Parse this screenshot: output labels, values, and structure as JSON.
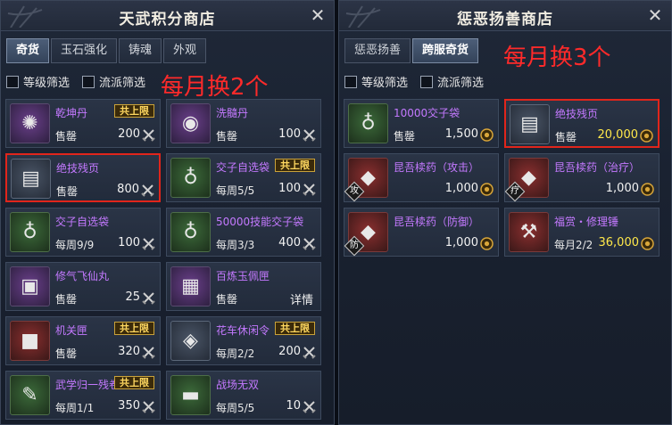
{
  "left": {
    "title": "天武积分商店",
    "close": "✕",
    "tabs": [
      {
        "label": "奇货",
        "active": true
      },
      {
        "label": "玉石强化",
        "active": false
      },
      {
        "label": "铸魂",
        "active": false
      },
      {
        "label": "外观",
        "active": false
      }
    ],
    "filters": [
      "等级筛选",
      "流派筛选"
    ],
    "annotation": "每月换2个",
    "items": [
      {
        "name": "乾坤丹",
        "limit": "共上限",
        "sub": "售罄",
        "price": "200",
        "icon": "golden-orb-icon",
        "thumb": "purple",
        "glyph": "✺"
      },
      {
        "name": "洗髓丹",
        "limit": "",
        "sub": "售罄",
        "price": "100",
        "icon": "pink-orb-icon",
        "thumb": "purple",
        "glyph": "◉"
      },
      {
        "name": "绝技残页",
        "limit": "",
        "sub": "售罄",
        "price": "800",
        "icon": "scroll-page-icon",
        "thumb": "blue",
        "glyph": "▤",
        "highlight": true
      },
      {
        "name": "交子自选袋",
        "limit": "共上限",
        "sub": "每周5/5",
        "price": "100",
        "icon": "money-bag-icon",
        "thumb": "green",
        "glyph": "♁"
      },
      {
        "name": "交子自选袋",
        "limit": "",
        "sub": "每周9/9",
        "price": "100",
        "icon": "money-bag-icon",
        "thumb": "green",
        "glyph": "♁"
      },
      {
        "name": "50000技能交子袋",
        "limit": "",
        "sub": "每周3/3",
        "price": "400",
        "icon": "money-bag-icon",
        "thumb": "green",
        "glyph": "♁"
      },
      {
        "name": "修气飞仙丸",
        "limit": "",
        "sub": "售罄",
        "price": "25",
        "icon": "treasure-chest-icon",
        "thumb": "purple",
        "glyph": "▣"
      },
      {
        "name": "百炼玉佩匣",
        "limit": "",
        "sub": "售罄",
        "price": "详情",
        "icon": "jade-box-icon",
        "thumb": "purple",
        "glyph": "▦",
        "noicon": true
      },
      {
        "name": "机关匣",
        "limit": "共上限",
        "sub": "售罄",
        "price": "320",
        "icon": "mechanism-box-icon",
        "thumb": "red",
        "glyph": "■"
      },
      {
        "name": "花车休闲令",
        "limit": "共上限",
        "sub": "每周2/2",
        "price": "200",
        "icon": "token-icon",
        "thumb": "blue",
        "glyph": "◈"
      },
      {
        "name": "武学归一残卷",
        "limit": "共上限",
        "sub": "每周1/1",
        "price": "350",
        "icon": "scroll-fragment-icon",
        "thumb": "green",
        "glyph": "✎"
      },
      {
        "name": "战场无双",
        "limit": "",
        "sub": "每周5/5",
        "price": "10",
        "icon": "book-icon",
        "thumb": "green",
        "glyph": "▬"
      }
    ]
  },
  "right": {
    "title": "惩恶扬善商店",
    "close": "✕",
    "tabs": [
      {
        "label": "惩恶扬善",
        "active": false
      },
      {
        "label": "跨服奇货",
        "active": true
      }
    ],
    "filters": [
      "等级筛选",
      "流派筛选"
    ],
    "annotation": "每月换3个",
    "items": [
      {
        "name": "10000交子袋",
        "limit": "",
        "sub": "售罄",
        "price": "1,500",
        "icon": "money-bag-icon",
        "thumb": "green",
        "glyph": "♁"
      },
      {
        "name": "绝技残页",
        "limit": "",
        "sub": "售罄",
        "price": "20,000",
        "gold": true,
        "icon": "scroll-page-icon",
        "thumb": "blue",
        "glyph": "▤",
        "highlight": true
      },
      {
        "name": "昆吾椟药（攻击）",
        "limit": "",
        "sub": "",
        "price": "1,000",
        "icon": "medicine-icon",
        "thumb": "red",
        "glyph": "◆",
        "tag": "攻"
      },
      {
        "name": "昆吾椟药（治疗）",
        "limit": "",
        "sub": "",
        "price": "1,000",
        "icon": "medicine-icon",
        "thumb": "red",
        "glyph": "◆",
        "tag": "疗"
      },
      {
        "name": "昆吾椟药（防御）",
        "limit": "",
        "sub": "",
        "price": "1,000",
        "icon": "medicine-icon",
        "thumb": "red",
        "glyph": "◆",
        "tag": "防"
      },
      {
        "name": "福赏・修理锤",
        "limit": "",
        "sub": "每月2/2",
        "price": "36,000",
        "gold": true,
        "icon": "hammer-icon",
        "thumb": "red",
        "glyph": "⚒"
      }
    ]
  },
  "colors": {
    "accent_purple": "#c479ff",
    "limit_gold": "#ffd860",
    "highlight_red": "#e1251b",
    "annotation_red": "#ff2a2a"
  }
}
